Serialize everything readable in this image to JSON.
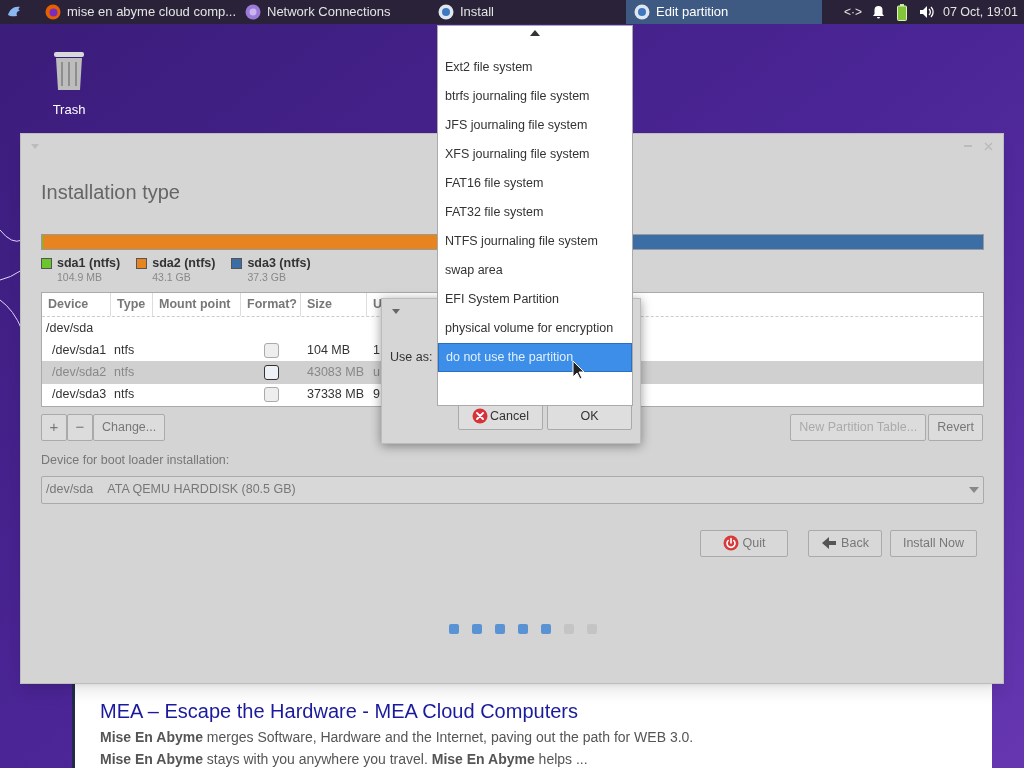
{
  "taskbar": {
    "tasks": [
      {
        "kind": "firefox",
        "label": "mise en abyme cloud comp...",
        "selected": false
      },
      {
        "kind": "network",
        "label": "Network Connections",
        "selected": false
      },
      {
        "kind": "installer",
        "label": "Install",
        "selected": false
      },
      {
        "kind": "installer",
        "label": "Edit partition",
        "selected": true
      }
    ],
    "tray_network": "<·>",
    "clock": "07 Oct, 19:01"
  },
  "desktop_icons": [
    {
      "label": "Trash"
    }
  ],
  "browser": {
    "result_title": "MEA – Escape the Hardware - MEA Cloud Computers",
    "snippets": [
      "**Mise En Abyme** merges Software, Hardware and the Internet, paving out the path for WEB 3.0.",
      "**Mise En Abyme** stays with you anywhere you travel. **Mise En Abyme** helps ..."
    ]
  },
  "installer": {
    "title": "Installation type",
    "partitions": [
      {
        "name": "sda1 (ntfs)",
        "size": "104.9 MB",
        "color": "#6cc52b",
        "level": 0.0012
      },
      {
        "name": "sda2 (ntfs)",
        "size": "43.1 GB",
        "color": "#e8841f",
        "level": 0.5358
      },
      {
        "name": "sda3 (ntfs)",
        "size": "37.3 GB",
        "color": "#3b6ea5",
        "level": 0.463
      }
    ],
    "table": {
      "columns": [
        "Device",
        "Type",
        "Mount point",
        "Format?",
        "Size",
        "U"
      ],
      "disk": "/dev/sda",
      "rows": [
        {
          "device": "/dev/sda1",
          "type": "ntfs",
          "format": false,
          "size": "104 MB",
          "used": "1",
          "selected": false
        },
        {
          "device": "/dev/sda2",
          "type": "ntfs",
          "format": false,
          "size": "43083 MB",
          "used": "u",
          "selected": true
        },
        {
          "device": "/dev/sda3",
          "type": "ntfs",
          "format": false,
          "size": "37338 MB",
          "used": "9",
          "selected": false
        }
      ]
    },
    "table_buttons": [
      {
        "label": "+",
        "disabled": false
      },
      {
        "label": "−",
        "disabled": false
      },
      {
        "label": "Change...",
        "disabled": false
      }
    ],
    "right_buttons": [
      {
        "label": "New Partition Table...",
        "disabled": true
      },
      {
        "label": "Revert",
        "disabled": false
      }
    ],
    "boot_label": "Device for boot loader installation:",
    "boot_device": "/dev/sda",
    "boot_desc": "ATA QEMU HARDDISK (80.5 GB)",
    "nav_buttons": [
      {
        "kind": "quit",
        "label": "Quit"
      },
      {
        "kind": "back",
        "label": "Back"
      },
      {
        "kind": "plain",
        "label": "Install Now"
      }
    ],
    "steps": [
      {
        "done": true
      },
      {
        "done": true
      },
      {
        "done": true
      },
      {
        "done": true
      },
      {
        "done": true
      },
      {
        "done": false
      },
      {
        "done": false
      }
    ]
  },
  "dialog": {
    "use_as_label": "Use as:",
    "buttons": [
      {
        "kind": "cancel",
        "label": "Cancel"
      },
      {
        "kind": "plain",
        "label": "OK"
      }
    ]
  },
  "dropdown": {
    "items": [
      {
        "label": "Ext2 file system",
        "selected": false
      },
      {
        "label": "btrfs journaling file system",
        "selected": false
      },
      {
        "label": "JFS journaling file system",
        "selected": false
      },
      {
        "label": "XFS journaling file system",
        "selected": false
      },
      {
        "label": "FAT16 file system",
        "selected": false
      },
      {
        "label": "FAT32 file system",
        "selected": false
      },
      {
        "label": "NTFS journaling file system",
        "selected": false
      },
      {
        "label": "swap area",
        "selected": false
      },
      {
        "label": "EFI System Partition",
        "selected": false
      },
      {
        "label": "physical volume for encryption",
        "selected": false
      },
      {
        "label": "do not use the partition",
        "selected": true
      }
    ]
  }
}
